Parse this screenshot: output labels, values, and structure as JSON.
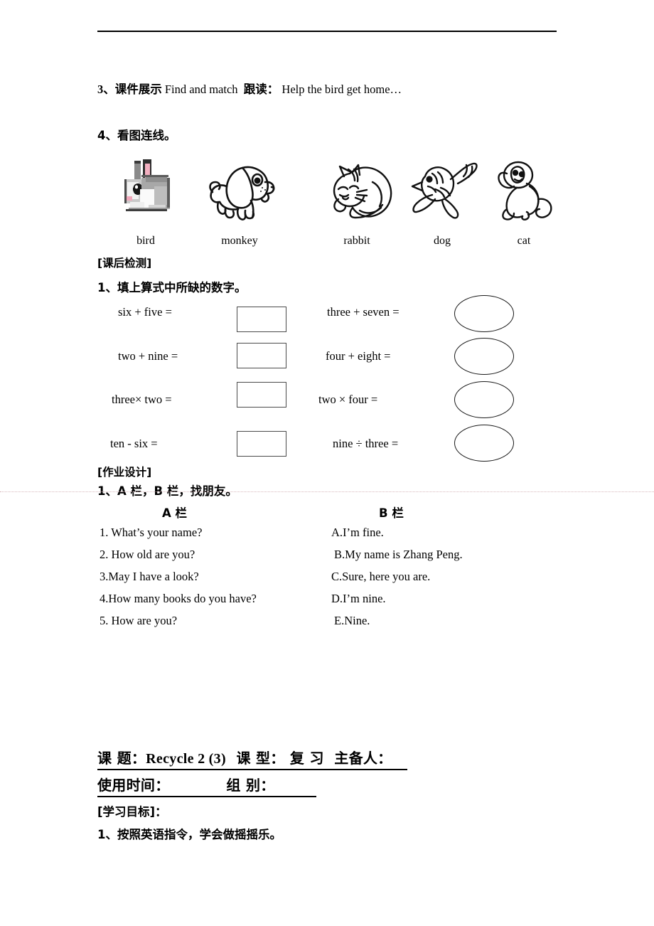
{
  "document": {
    "section_3": {
      "number": "3、",
      "cn_label": "课件展示",
      "en_phrase": "Find and match",
      "cn_read": "跟读：",
      "en_sentence": "Help the bird get home…"
    },
    "section_4": {
      "number": "4、",
      "cn_label": "看图连线。"
    },
    "match_pictures": {
      "items": [
        {
          "art": "rabbit-photo",
          "label": "bird"
        },
        {
          "art": "dog-line",
          "label": "monkey"
        },
        {
          "art": "cat-line",
          "label": "rabbit"
        },
        {
          "art": "bird-line",
          "label": "dog"
        },
        {
          "art": "monkey-line",
          "label": "cat"
        }
      ]
    },
    "post_class_test": {
      "heading": "[课后检测]",
      "task_1": "1、填上算式中所缺的数字。",
      "equations_left": [
        {
          "text": "six + five   =",
          "answer_shape": "rect"
        },
        {
          "text": "two + nine   =",
          "answer_shape": "rect"
        },
        {
          "text": "three× two   =",
          "answer_shape": "rect"
        },
        {
          "text": "ten  -   six   =",
          "answer_shape": "rect"
        }
      ],
      "equations_right": [
        {
          "text": "three + seven   =",
          "answer_shape": "ellipse"
        },
        {
          "text": "four   + eight   =",
          "answer_shape": "ellipse"
        },
        {
          "text": "two    ×   four   =",
          "answer_shape": "ellipse"
        },
        {
          "text": "nine ÷   three =",
          "answer_shape": "ellipse"
        }
      ]
    },
    "homework_design": {
      "heading": "[作业设计]",
      "task_1": "1、A 栏，B 栏，找朋友。",
      "column_a_head": "A 栏",
      "column_b_head": "B 栏",
      "column_a": [
        "1. What’s your name?",
        "2. How old are you?",
        "3.May I have a look?",
        "4.How many books do you have?",
        "5. How are you?"
      ],
      "column_b": [
        "A.I’m fine.",
        "B.My name is Zhang Peng.",
        "C.Sure, here you are.",
        "D.I’m nine.",
        "E.Nine."
      ]
    },
    "lesson_header": {
      "subject_label": "课    题：",
      "subject_value": "Recycle 2 (3)",
      "type_label": "课  型：",
      "type_value": "复 习",
      "author_label": "主备人：",
      "author_value": "",
      "date_label": "使用时间：",
      "date_value": "",
      "group_label": "组   别：",
      "group_value": ""
    },
    "objectives": {
      "heading": "[学习目标]：",
      "items": [
        "1、按照英语指令，学会做摇摇乐。"
      ]
    }
  }
}
